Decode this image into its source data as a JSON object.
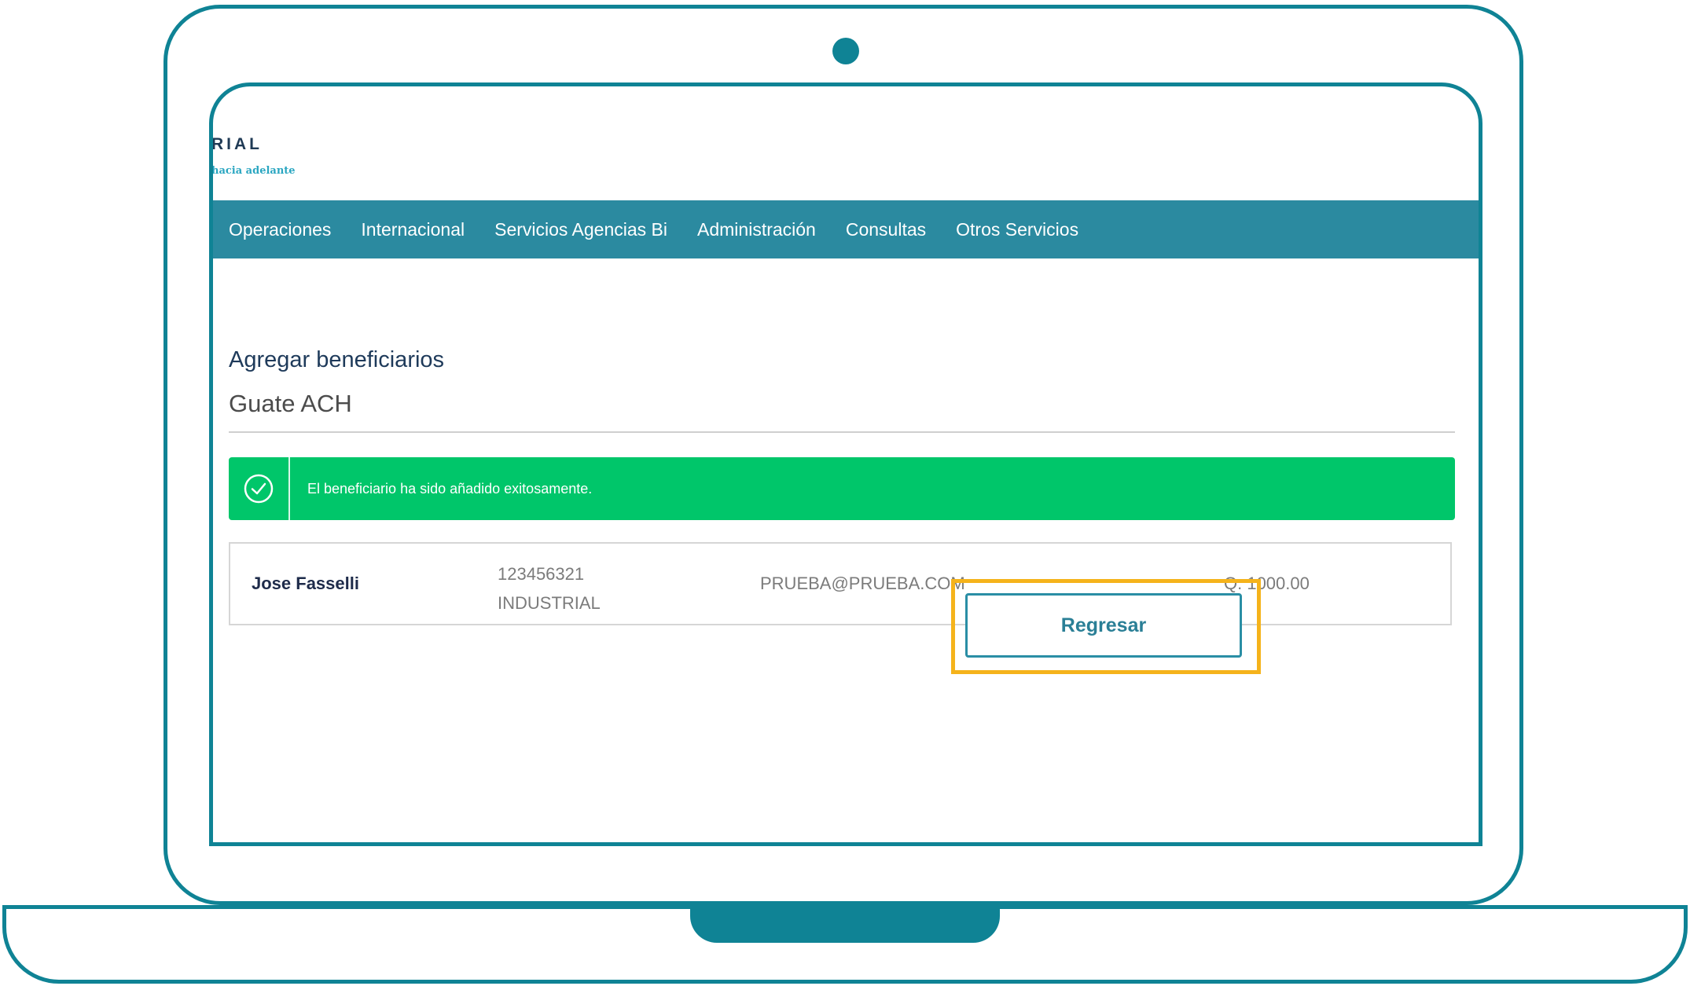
{
  "brand": {
    "logo_text": "RIAL",
    "tagline": "hacia adelante",
    "accent": "#2b8aa0",
    "frame_color": "#0f8395"
  },
  "nav": {
    "items": [
      {
        "label": "Operaciones"
      },
      {
        "label": "Internacional"
      },
      {
        "label": "Servicios Agencias Bi"
      },
      {
        "label": "Administración"
      },
      {
        "label": "Consultas"
      },
      {
        "label": "Otros Servicios"
      }
    ]
  },
  "page": {
    "title": "Agregar beneficiarios",
    "subtitle": "Guate ACH"
  },
  "alert": {
    "message": "El beneficiario ha sido añadido exitosamente.",
    "icon": "check-circle-icon",
    "color": "#00c66a"
  },
  "beneficiary": {
    "name": "Jose Fasselli",
    "account_number": "123456321",
    "bank": "INDUSTRIAL",
    "email": "PRUEBA@PRUEBA.COM",
    "amount": "Q. 1000.00"
  },
  "actions": {
    "back_label": "Regresar",
    "highlight_color": "#f5b31b"
  }
}
